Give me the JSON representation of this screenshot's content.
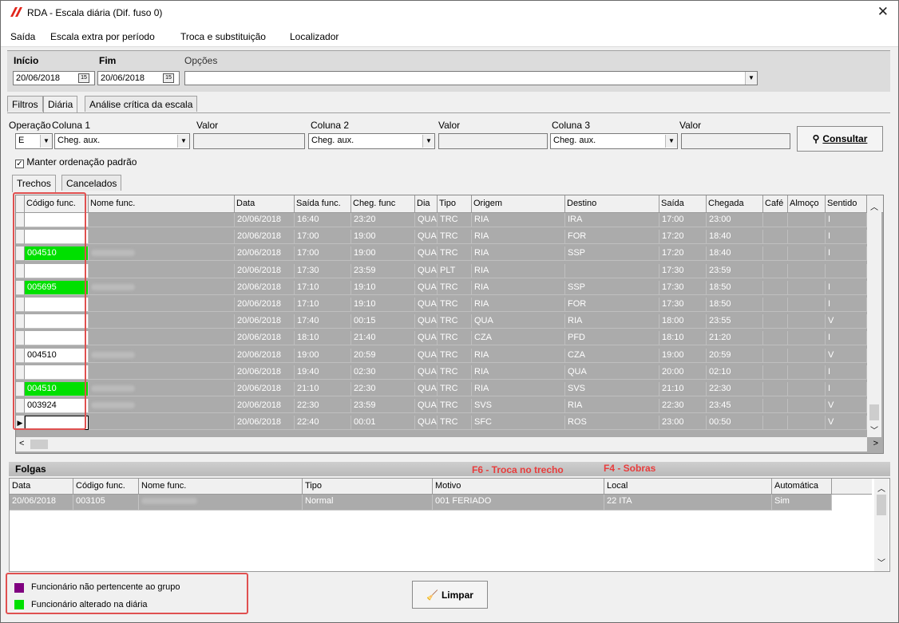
{
  "window": {
    "title": "RDA - Escala diária (Dif. fuso 0)"
  },
  "menu": [
    "Saída",
    "Escala extra por período",
    "Troca e substituição",
    "Localizador"
  ],
  "filters": {
    "inicio_label": "Início",
    "fim_label": "Fim",
    "opcoes_label": "Opções",
    "inicio_value": "20/06/2018",
    "fim_value": "20/06/2018",
    "opcoes_value": ""
  },
  "main_tabs": [
    "Filtros",
    "Diária",
    "Análise crítica da escala"
  ],
  "ops": {
    "operacao_label": "Operação",
    "coluna1_label": "Coluna 1",
    "valor_label": "Valor",
    "coluna2_label": "Coluna 2",
    "coluna3_label": "Coluna 3",
    "operacao_value": "E",
    "coluna1_value": "Cheg. aux.",
    "coluna2_value": "Cheg. aux.",
    "coluna3_value": "Cheg. aux.",
    "valor1": "",
    "valor2": "",
    "valor3": "",
    "consultar_label": "Consultar",
    "manter_label": "Manter ordenação padrão",
    "manter_checked": true
  },
  "sub_tabs": [
    "Trechos",
    "Cancelados"
  ],
  "trechos": {
    "columns": [
      "Código func.",
      "Nome func.",
      "Data",
      "Saída func.",
      "Cheg. func",
      "Dia",
      "Tipo",
      "Origem",
      "Destino",
      "Saída",
      "Chegada",
      "Café",
      "Almoço",
      "Sentido"
    ],
    "rows": [
      {
        "codigo": "",
        "nome": "",
        "data": "20/06/2018",
        "saida_func": "16:40",
        "cheg_func": "23:20",
        "dia": "QUA",
        "tipo": "TRC",
        "origem": "RIA",
        "destino": "IRA",
        "saida": "17:00",
        "chegada": "23:00",
        "cafe": "",
        "almoco": "",
        "sentido": "I",
        "status": "normal"
      },
      {
        "codigo": "",
        "nome": "",
        "data": "20/06/2018",
        "saida_func": "17:00",
        "cheg_func": "19:00",
        "dia": "QUA",
        "tipo": "TRC",
        "origem": "RIA",
        "destino": "FOR",
        "saida": "17:20",
        "chegada": "18:40",
        "cafe": "",
        "almoco": "",
        "sentido": "I",
        "status": "normal"
      },
      {
        "codigo": "004510",
        "nome": "",
        "data": "20/06/2018",
        "saida_func": "17:00",
        "cheg_func": "19:00",
        "dia": "QUA",
        "tipo": "TRC",
        "origem": "RIA",
        "destino": "SSP",
        "saida": "17:20",
        "chegada": "18:40",
        "cafe": "",
        "almoco": "",
        "sentido": "I",
        "status": "altered"
      },
      {
        "codigo": "",
        "nome": "",
        "data": "20/06/2018",
        "saida_func": "17:30",
        "cheg_func": "23:59",
        "dia": "QUA",
        "tipo": "PLT",
        "origem": "RIA",
        "destino": "",
        "saida": "17:30",
        "chegada": "23:59",
        "cafe": "",
        "almoco": "",
        "sentido": "",
        "status": "normal"
      },
      {
        "codigo": "005695",
        "nome": "",
        "data": "20/06/2018",
        "saida_func": "17:10",
        "cheg_func": "19:10",
        "dia": "QUA",
        "tipo": "TRC",
        "origem": "RIA",
        "destino": "SSP",
        "saida": "17:30",
        "chegada": "18:50",
        "cafe": "",
        "almoco": "",
        "sentido": "I",
        "status": "altered"
      },
      {
        "codigo": "",
        "nome": "",
        "data": "20/06/2018",
        "saida_func": "17:10",
        "cheg_func": "19:10",
        "dia": "QUA",
        "tipo": "TRC",
        "origem": "RIA",
        "destino": "FOR",
        "saida": "17:30",
        "chegada": "18:50",
        "cafe": "",
        "almoco": "",
        "sentido": "I",
        "status": "normal"
      },
      {
        "codigo": "",
        "nome": "",
        "data": "20/06/2018",
        "saida_func": "17:40",
        "cheg_func": "00:15",
        "dia": "QUA",
        "tipo": "TRC",
        "origem": "QUA",
        "destino": "RIA",
        "saida": "18:00",
        "chegada": "23:55",
        "cafe": "",
        "almoco": "",
        "sentido": "V",
        "status": "normal"
      },
      {
        "codigo": "",
        "nome": "",
        "data": "20/06/2018",
        "saida_func": "18:10",
        "cheg_func": "21:40",
        "dia": "QUA",
        "tipo": "TRC",
        "origem": "CZA",
        "destino": "PFD",
        "saida": "18:10",
        "chegada": "21:20",
        "cafe": "",
        "almoco": "",
        "sentido": "I",
        "status": "normal"
      },
      {
        "codigo": "004510",
        "nome": "",
        "data": "20/06/2018",
        "saida_func": "19:00",
        "cheg_func": "20:59",
        "dia": "QUA",
        "tipo": "TRC",
        "origem": "RIA",
        "destino": "CZA",
        "saida": "19:00",
        "chegada": "20:59",
        "cafe": "",
        "almoco": "",
        "sentido": "V",
        "status": "normal"
      },
      {
        "codigo": "",
        "nome": "",
        "data": "20/06/2018",
        "saida_func": "19:40",
        "cheg_func": "02:30",
        "dia": "QUA",
        "tipo": "TRC",
        "origem": "RIA",
        "destino": "QUA",
        "saida": "20:00",
        "chegada": "02:10",
        "cafe": "",
        "almoco": "",
        "sentido": "I",
        "status": "normal"
      },
      {
        "codigo": "004510",
        "nome": "",
        "data": "20/06/2018",
        "saida_func": "21:10",
        "cheg_func": "22:30",
        "dia": "QUA",
        "tipo": "TRC",
        "origem": "RIA",
        "destino": "SVS",
        "saida": "21:10",
        "chegada": "22:30",
        "cafe": "",
        "almoco": "",
        "sentido": "I",
        "status": "altered"
      },
      {
        "codigo": "003924",
        "nome": "",
        "data": "20/06/2018",
        "saida_func": "22:30",
        "cheg_func": "23:59",
        "dia": "QUA",
        "tipo": "TRC",
        "origem": "SVS",
        "destino": "RIA",
        "saida": "22:30",
        "chegada": "23:45",
        "cafe": "",
        "almoco": "",
        "sentido": "V",
        "status": "normal"
      },
      {
        "codigo": "",
        "nome": "",
        "data": "20/06/2018",
        "saida_func": "22:40",
        "cheg_func": "00:01",
        "dia": "QUA",
        "tipo": "TRC",
        "origem": "SFC",
        "destino": "ROS",
        "saida": "23:00",
        "chegada": "00:50",
        "cafe": "",
        "almoco": "",
        "sentido": "V",
        "status": "selected"
      }
    ]
  },
  "folgas": {
    "title": "Folgas",
    "hint1": "F6 - Troca no trecho",
    "hint2": "F4 - Sobras",
    "columns": [
      "Data",
      "Código func.",
      "Nome func.",
      "Tipo",
      "Motivo",
      "Local",
      "Automática"
    ],
    "rows": [
      {
        "data": "20/06/2018",
        "codigo": "003105",
        "nome": "",
        "tipo": "Normal",
        "motivo": "001 FERIADO",
        "local": "22 ITA",
        "automatica": "Sim"
      }
    ]
  },
  "legend": [
    {
      "label": "Funcionário não pertencente ao grupo",
      "color": "#800080"
    },
    {
      "label": "Funcionário alterado na diária",
      "color": "#00e000"
    }
  ],
  "limpar_label": "Limpar",
  "colors": {
    "altered": "#00e000",
    "grid_bg": "#ababab",
    "highlight": "#e05050"
  }
}
